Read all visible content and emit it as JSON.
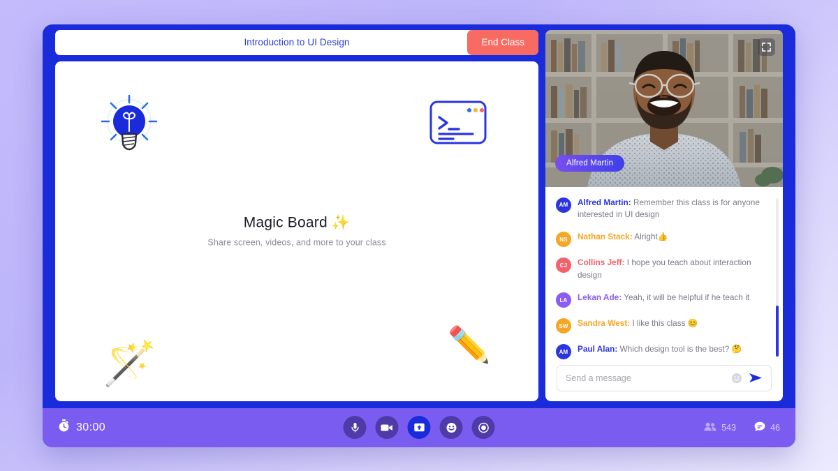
{
  "header": {
    "class_title": "Introduction to UI Design",
    "end_class_label": "End Class",
    "end_class_color": "#f76b63",
    "title_color": "#2b3bdc"
  },
  "board": {
    "title": "Magic Board ✨",
    "subtitle": "Share screen, videos, and more to your class",
    "decorations": [
      {
        "name": "lightbulb-icon",
        "glyph": ""
      },
      {
        "name": "terminal-icon",
        "glyph": ""
      },
      {
        "name": "magic-wand-emoji",
        "glyph": "🪄"
      },
      {
        "name": "pencil-emoji",
        "glyph": "✏️"
      }
    ]
  },
  "video": {
    "presenter_name": "Alfred Martin",
    "fullscreen_icon": "fullscreen-icon",
    "badge_gradient_from": "#7a4ff0",
    "badge_gradient_to": "#3e3fe8"
  },
  "chat": {
    "messages": [
      {
        "initials": "AM",
        "author": "Alfred Martin:",
        "text": " Remember this class is for anyone interested in UI design",
        "avatar_color": "#2b35e0",
        "author_color": "#2b35e0"
      },
      {
        "initials": "NS",
        "author": "Nathan Stack:",
        "text": " Alright👍",
        "avatar_color": "#f5a623",
        "author_color": "#f5a623"
      },
      {
        "initials": "CJ",
        "author": "Collins Jeff:",
        "text": " I hope you teach about interaction design",
        "avatar_color": "#f4616d",
        "author_color": "#f4616d"
      },
      {
        "initials": "LA",
        "author": "Lekan Ade:",
        "text": "  Yeah, it will be helpful if he teach it",
        "avatar_color": "#8b5cf6",
        "author_color": "#8b5cf6"
      },
      {
        "initials": "SW",
        "author": "Sandra West:",
        "text": " I like this class 😊",
        "avatar_color": "#f5a623",
        "author_color": "#f5a623"
      },
      {
        "initials": "AM",
        "author": "Paul Alan:",
        "text": " Which design tool is the best? 🤔",
        "avatar_color": "#2b35e0",
        "author_color": "#2b35e0"
      }
    ],
    "input_placeholder": "Send a message",
    "input_value": "",
    "emoji_icon": "emoji-icon",
    "send_icon": "send-icon"
  },
  "toolbar": {
    "timer": "30:00",
    "timer_icon": "stopwatch-icon",
    "controls": [
      {
        "name": "microphone-button",
        "icon": "microphone-icon",
        "active": false
      },
      {
        "name": "camera-button",
        "icon": "video-camera-icon",
        "active": false
      },
      {
        "name": "share-screen-button",
        "icon": "share-screen-icon",
        "active": true
      },
      {
        "name": "reactions-button",
        "icon": "smiley-icon",
        "active": false
      },
      {
        "name": "record-button",
        "icon": "record-icon",
        "active": false
      }
    ],
    "participants_count": "543",
    "participants_icon": "people-icon",
    "messages_count": "46",
    "messages_icon": "chat-bubble-icon",
    "background_color": "#7b5cf0"
  }
}
